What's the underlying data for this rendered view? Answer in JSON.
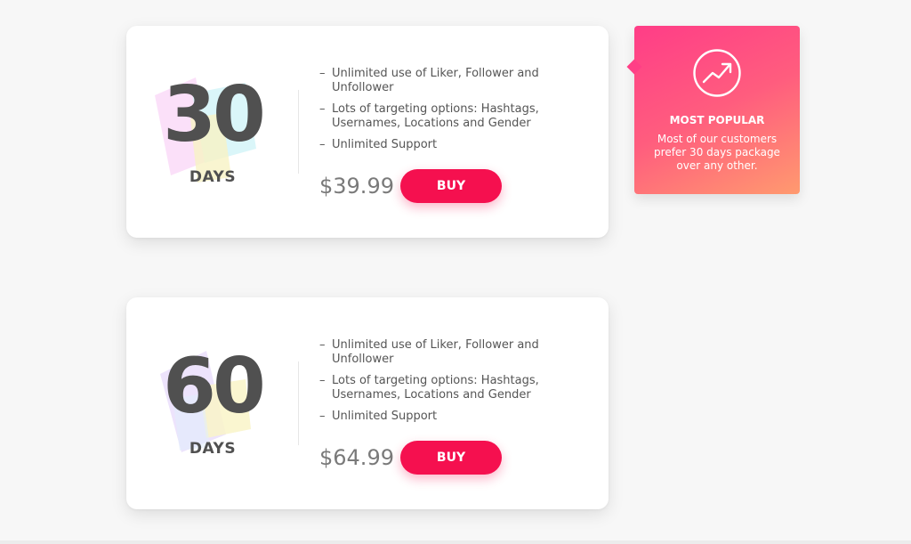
{
  "packages": [
    {
      "days": "30",
      "days_label": "DAYS",
      "features": [
        "Unlimited use of Liker, Follower and Unfollower",
        "Lots of targeting options: Hashtags, Usernames, Locations and Gender",
        "Unlimited Support"
      ],
      "price": "$39.99",
      "buy_label": "BUY"
    },
    {
      "days": "60",
      "days_label": "DAYS",
      "features": [
        "Unlimited use of Liker, Follower and Unfollower",
        "Lots of targeting options: Hashtags, Usernames, Locations and Gender",
        "Unlimited Support"
      ],
      "price": "$64.99",
      "buy_label": "BUY"
    }
  ],
  "feature_bullet": "–",
  "popular": {
    "icon": "trending-up-icon",
    "title": "MOST POPULAR",
    "text": "Most of our customers prefer 30 days package over any other."
  },
  "colors": {
    "buy_button": "#f5104f",
    "popular_gradient_start": "#ff3d87",
    "popular_gradient_end": "#ff9a6f",
    "heading_text": "#505050",
    "price_text": "#7a7a7a"
  }
}
